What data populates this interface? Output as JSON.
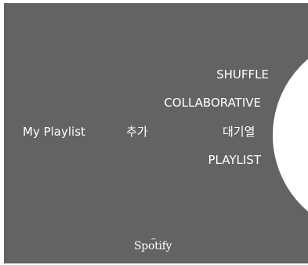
{
  "screen": {
    "background_color": "#636363",
    "circle_color": "#ffffff"
  },
  "menu": {
    "shuffle": "SHUFFLE",
    "collaborative": "COLLABORATIVE",
    "my_playlist": "My Playlist",
    "add": "추가",
    "queue": "대기열",
    "playlist": "PLAYLIST"
  },
  "footer": {
    "brand": "Spotify"
  }
}
